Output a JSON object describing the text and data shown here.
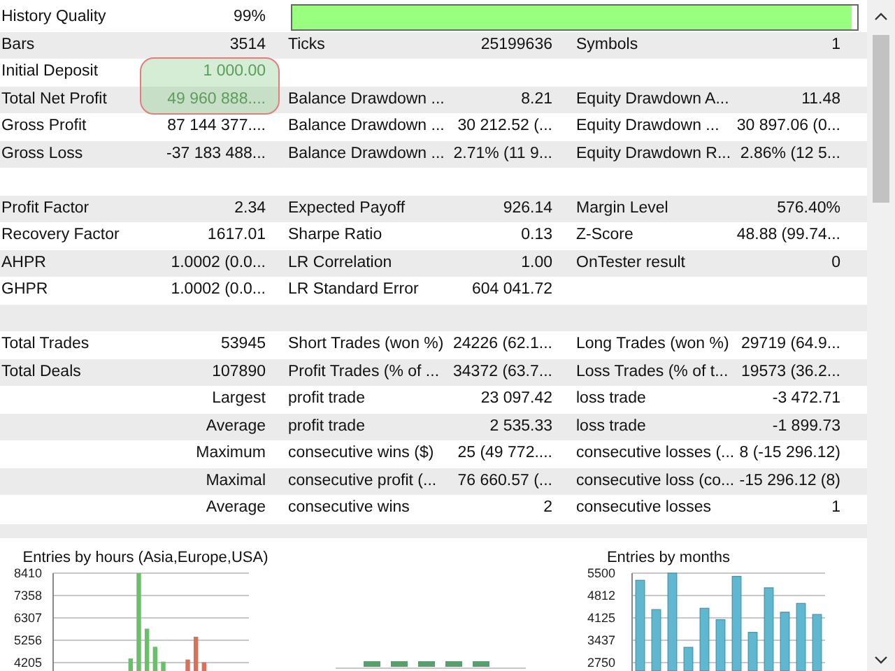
{
  "rows": [
    {
      "kind": "quality",
      "cells": [
        "History Quality",
        "99%"
      ],
      "level": 0.99
    },
    {
      "kind": "stats",
      "cells": [
        "Bars",
        "3514",
        "Ticks",
        "25199636",
        "Symbols",
        "1"
      ]
    },
    {
      "kind": "stats",
      "cells": [
        "Initial Deposit",
        "1 000.00"
      ],
      "highlighted": true
    },
    {
      "kind": "stats",
      "cells": [
        "Total Net Profit",
        "49 960 888....",
        "Balance Drawdown ...",
        "8.21",
        "Equity Drawdown A...",
        "11.48"
      ],
      "highlighted": true
    },
    {
      "kind": "stats",
      "cells": [
        "Gross Profit",
        "87 144 377....",
        "Balance Drawdown ...",
        "30 212.52 (...",
        "Equity Drawdown ...",
        "30 897.06 (0..."
      ]
    },
    {
      "kind": "stats",
      "cells": [
        "Gross Loss",
        "-37 183 488...",
        "Balance Drawdown ...",
        "2.71% (11 9...",
        "Equity Drawdown R...",
        "2.86% (12 5..."
      ]
    },
    {
      "kind": "blank",
      "cells": []
    },
    {
      "kind": "stats",
      "cells": [
        "Profit Factor",
        "2.34",
        "Expected Payoff",
        "926.14",
        "Margin Level",
        "576.40%"
      ]
    },
    {
      "kind": "stats",
      "cells": [
        "Recovery Factor",
        "1617.01",
        "Sharpe Ratio",
        "0.13",
        "Z-Score",
        "48.88 (99.74..."
      ]
    },
    {
      "kind": "stats",
      "cells": [
        "AHPR",
        "1.0002 (0.0...",
        "LR Correlation",
        "1.00",
        "OnTester result",
        "0"
      ]
    },
    {
      "kind": "stats",
      "cells": [
        "GHPR",
        "1.0002 (0.0...",
        "LR Standard Error",
        "604 041.72"
      ]
    },
    {
      "kind": "blank",
      "cells": []
    },
    {
      "kind": "stats",
      "cells": [
        "Total Trades",
        "53945",
        "Short Trades (won %)",
        "24226 (62.1...",
        "Long Trades (won %)",
        "29719 (64.9..."
      ]
    },
    {
      "kind": "stats",
      "cells": [
        "Total Deals",
        "107890",
        "Profit Trades (% of ...",
        "34372 (63.7...",
        "Loss Trades (% of t...",
        "19573 (36.2..."
      ]
    },
    {
      "kind": "sub",
      "cells": [
        "Largest",
        "",
        "profit trade",
        "23 097.42",
        "loss trade",
        "-3 472.71"
      ]
    },
    {
      "kind": "sub",
      "cells": [
        "Average",
        "",
        "profit trade",
        "2 535.33",
        "loss trade",
        "-1 899.73"
      ]
    },
    {
      "kind": "sub",
      "cells": [
        "Maximum",
        "",
        "consecutive wins ($)",
        "25 (49 772....",
        "consecutive losses (...",
        "8 (-15 296.12)"
      ]
    },
    {
      "kind": "sub",
      "cells": [
        "Maximal",
        "",
        "consecutive profit (...",
        "76 660.57 (...",
        "consecutive loss (co...",
        "-15 296.12 (8)"
      ]
    },
    {
      "kind": "sub",
      "cells": [
        "Average",
        "",
        "consecutive wins",
        "2",
        "consecutive losses",
        "1"
      ]
    }
  ],
  "charts": [
    {
      "chart_data": {
        "type": "bar",
        "title": "Entries by hours (Asia,Europe,USA)",
        "ylim": [
          4205,
          8410
        ],
        "yticks": [
          4205,
          5256,
          6307,
          7358,
          8410
        ],
        "stacked": true,
        "grid": true,
        "series": [
          {
            "color": "#6abf69",
            "values": [
              null,
              null,
              null,
              null,
              null,
              null,
              null,
              null,
              null,
              4400,
              8410,
              5800,
              4950,
              4250,
              null,
              null,
              null,
              null,
              null,
              null,
              null,
              null,
              null,
              null
            ]
          },
          {
            "color": "#d9705a",
            "values": [
              null,
              null,
              null,
              null,
              null,
              null,
              null,
              null,
              null,
              null,
              null,
              null,
              null,
              null,
              null,
              null,
              4350,
              5420,
              4220,
              null,
              null,
              null,
              null,
              null
            ]
          }
        ]
      }
    },
    {
      "chart_data": {
        "type": "bar",
        "title": "Entries by months",
        "ylim": [
          2750,
          5500
        ],
        "yticks": [
          2750,
          3437,
          4125,
          4812,
          5500
        ],
        "stacked": false,
        "grid": true,
        "series": [
          {
            "color": "#5fb8d0",
            "values": [
              5280,
              4380,
              5500,
              3220,
              4420,
              4070,
              5400,
              3680,
              5050,
              4300,
              4570,
              4230
            ]
          }
        ]
      }
    }
  ]
}
